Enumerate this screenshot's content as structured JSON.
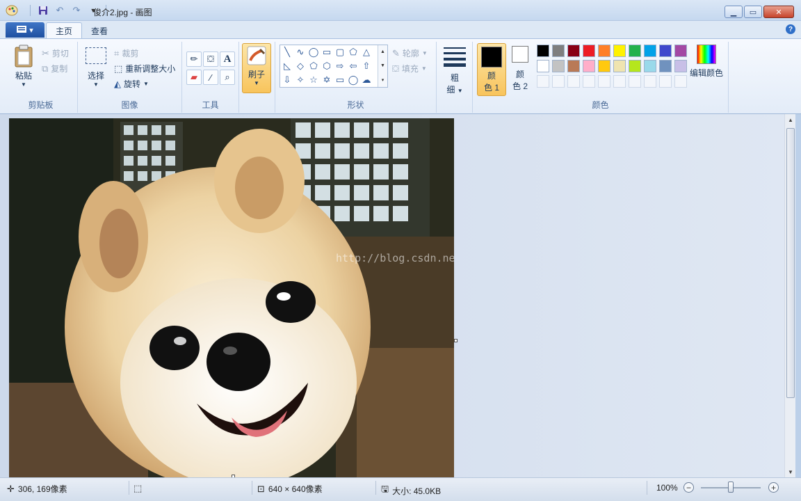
{
  "window": {
    "title": "俊介2.jpg - 画图"
  },
  "tabs": {
    "file_label": "▾",
    "home": "主页",
    "view": "查看"
  },
  "ribbon": {
    "clipboard": {
      "label": "剪贴板",
      "paste": "粘贴",
      "cut": "剪切",
      "copy": "复制"
    },
    "image": {
      "label": "图像",
      "select": "选择",
      "crop": "裁剪",
      "resize": "重新调整大小",
      "rotate": "旋转"
    },
    "tools": {
      "label": "工具"
    },
    "brushes": {
      "label": "刷子"
    },
    "shapes": {
      "label": "形状",
      "outline": "轮廓",
      "fill": "填充"
    },
    "size": {
      "label_top": "粗",
      "label_bottom": "细"
    },
    "colors": {
      "label": "颜色",
      "color1_top": "颜",
      "color1_bottom": "色 1",
      "color2_top": "颜",
      "color2_bottom": "色 2",
      "edit": "编辑颜色",
      "color1": "#000000",
      "color2": "#ffffff",
      "palette_row1": [
        "#000000",
        "#7f7f7f",
        "#880015",
        "#ed1c24",
        "#ff7f27",
        "#fff200",
        "#22b14c",
        "#00a2e8",
        "#3f48cc",
        "#a349a4"
      ],
      "palette_row2": [
        "#ffffff",
        "#c3c3c3",
        "#b97a57",
        "#ffaec9",
        "#ffc90e",
        "#efe4b0",
        "#b5e61d",
        "#99d9ea",
        "#7092be",
        "#c8bfe7"
      ]
    }
  },
  "canvas": {
    "watermark": "http://blog.csdn.net/"
  },
  "status": {
    "cursor_pos": "306, 169像素",
    "image_size": "640 × 640像素",
    "file_size": "大小: 45.0KB",
    "zoom": "100%"
  }
}
